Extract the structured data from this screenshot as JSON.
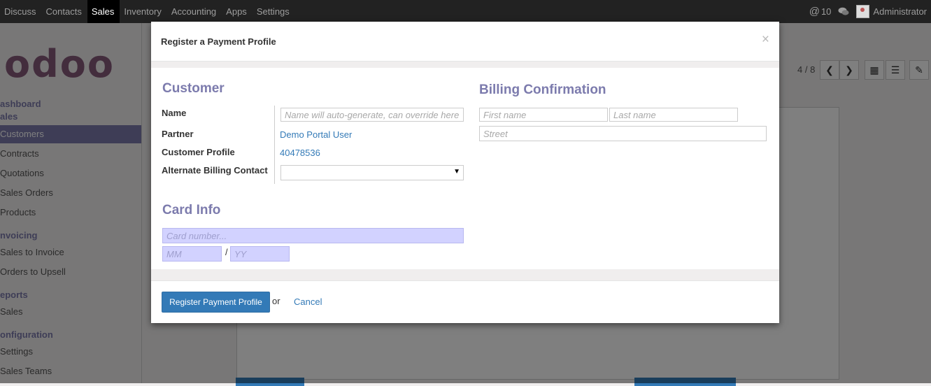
{
  "topbar": {
    "menu": [
      "Discuss",
      "Contacts",
      "Sales",
      "Inventory",
      "Accounting",
      "Apps",
      "Settings"
    ],
    "active": "Sales",
    "notifications": "10",
    "user": "Administrator"
  },
  "sidebar": {
    "logo": "odoo",
    "sections": {
      "dashboard": "ashboard",
      "sales": "ales",
      "invoicing": "nvoicing",
      "reports": "eports",
      "configuration": "onfiguration"
    },
    "items": {
      "customers": "Customers",
      "contracts": "Contracts",
      "quotations": "Quotations",
      "sales_orders": "Sales Orders",
      "products": "Products",
      "sales_to_invoice": "Sales to Invoice",
      "orders_to_upsell": "Orders to Upsell",
      "reports_sales": "Sales",
      "settings": "Settings",
      "sales_teams": "Sales Teams"
    }
  },
  "pager": {
    "text": "4 / 8"
  },
  "modal": {
    "title": "Register a Payment Profile",
    "close": "×",
    "customer_heading": "Customer",
    "name_label": "Name",
    "name_placeholder": "Name will auto-generate, can override here",
    "partner_label": "Partner",
    "partner_value": "Demo Portal User",
    "profile_label": "Customer Profile",
    "profile_value": "40478536",
    "alt_billing_label": "Alternate Billing Contact",
    "alt_billing_value": "",
    "billing_heading": "Billing Confirmation",
    "first_name_placeholder": "First name",
    "last_name_placeholder": "Last name",
    "street_placeholder": "Street",
    "card_heading": "Card Info",
    "card_number_placeholder": "Card number...",
    "mm_placeholder": "MM",
    "slash": "/",
    "yy_placeholder": "YY",
    "register_button": "Register Payment Profile",
    "or_text": "or",
    "cancel_link": "Cancel"
  },
  "colors": {
    "accent_purple": "#7c7bad",
    "primary_blue": "#337ab7",
    "card_input_bg": "#d2d2ff",
    "topbar_bg": "#222222"
  }
}
